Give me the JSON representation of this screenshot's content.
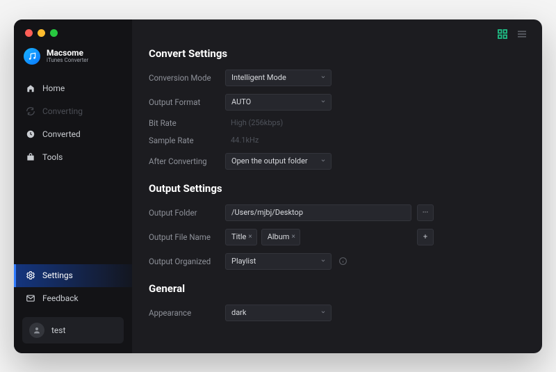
{
  "brand": {
    "name": "Macsome",
    "subtitle": "iTunes Converter"
  },
  "sidebar": {
    "items": [
      {
        "id": "home",
        "label": "Home"
      },
      {
        "id": "converting",
        "label": "Converting"
      },
      {
        "id": "converted",
        "label": "Converted"
      },
      {
        "id": "tools",
        "label": "Tools"
      }
    ],
    "bottom": [
      {
        "id": "settings",
        "label": "Settings"
      },
      {
        "id": "feedback",
        "label": "Feedback"
      }
    ],
    "user": {
      "name": "test"
    }
  },
  "sections": {
    "convert": {
      "title": "Convert Settings",
      "conversion_mode": {
        "label": "Conversion Mode",
        "value": "Intelligent Mode"
      },
      "output_format": {
        "label": "Output Format",
        "value": "AUTO"
      },
      "bit_rate": {
        "label": "Bit Rate",
        "value": "High (256kbps)"
      },
      "sample_rate": {
        "label": "Sample Rate",
        "value": "44.1kHz"
      },
      "after_converting": {
        "label": "After Converting",
        "value": "Open the output folder"
      }
    },
    "output": {
      "title": "Output Settings",
      "output_folder": {
        "label": "Output Folder",
        "value": "/Users/mjbj/Desktop",
        "browse": "···"
      },
      "output_file_name": {
        "label": "Output File Name",
        "tags": [
          "Title",
          "Album"
        ],
        "add": "+"
      },
      "output_organized": {
        "label": "Output Organized",
        "value": "Playlist"
      }
    },
    "general": {
      "title": "General",
      "appearance": {
        "label": "Appearance",
        "value": "dark"
      }
    }
  }
}
